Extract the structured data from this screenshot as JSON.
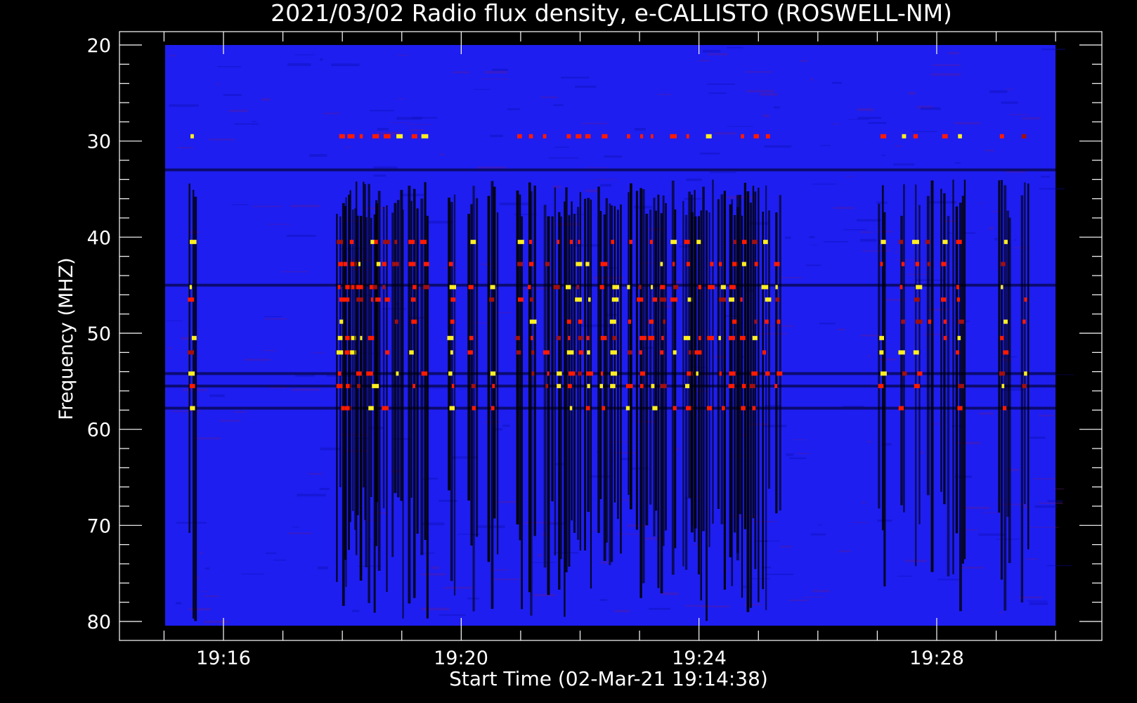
{
  "chart_data": {
    "type": "heatmap",
    "title": "2021/03/02  Radio flux density, e-CALLISTO (ROSWELL-NM)",
    "xlabel": "Start Time (02-Mar-21 19:14:38)",
    "ylabel": "Frequency (MHZ)",
    "x_range_minutes": [
      0,
      15.4
    ],
    "x_axis_start": "19:14:38",
    "x_ticks": [
      {
        "label": "19:16",
        "minutes": 1.37
      },
      {
        "label": "19:20",
        "minutes": 5.37
      },
      {
        "label": "19:24",
        "minutes": 9.37
      },
      {
        "label": "19:28",
        "minutes": 13.37
      }
    ],
    "y_range": [
      80.5,
      20
    ],
    "y_ticks": [
      20,
      30,
      40,
      50,
      60,
      70,
      80
    ],
    "y_inverted": true,
    "background_color": "#1e1ef0",
    "colormap": [
      "#000000",
      "#1a1aff",
      "#a01010",
      "#ff1a00",
      "#ffee22"
    ],
    "burst_columns_minutes": [
      0.85,
      3.35,
      3.45,
      3.55,
      3.67,
      3.85,
      3.95,
      4.1,
      4.3,
      4.55,
      4.75,
      5.2,
      5.55,
      5.9,
      6.35,
      6.55,
      6.8,
      7.0,
      7.2,
      7.35,
      7.5,
      7.75,
      7.95,
      8.2,
      8.4,
      8.6,
      8.75,
      8.95,
      9.2,
      9.35,
      9.55,
      9.75,
      9.95,
      10.1,
      10.3,
      10.5,
      10.7,
      12.45,
      12.8,
      13.05,
      13.25,
      13.5,
      13.75,
      14.5,
      14.85
    ],
    "bright_bands_mhz": [
      29.5,
      40.5,
      42.8,
      45.2,
      46.5,
      48.8,
      50.5,
      52,
      54.2,
      55.5,
      57.8
    ],
    "dark_lines_mhz": [
      33,
      45,
      54.2,
      55.5,
      57.8
    ]
  }
}
